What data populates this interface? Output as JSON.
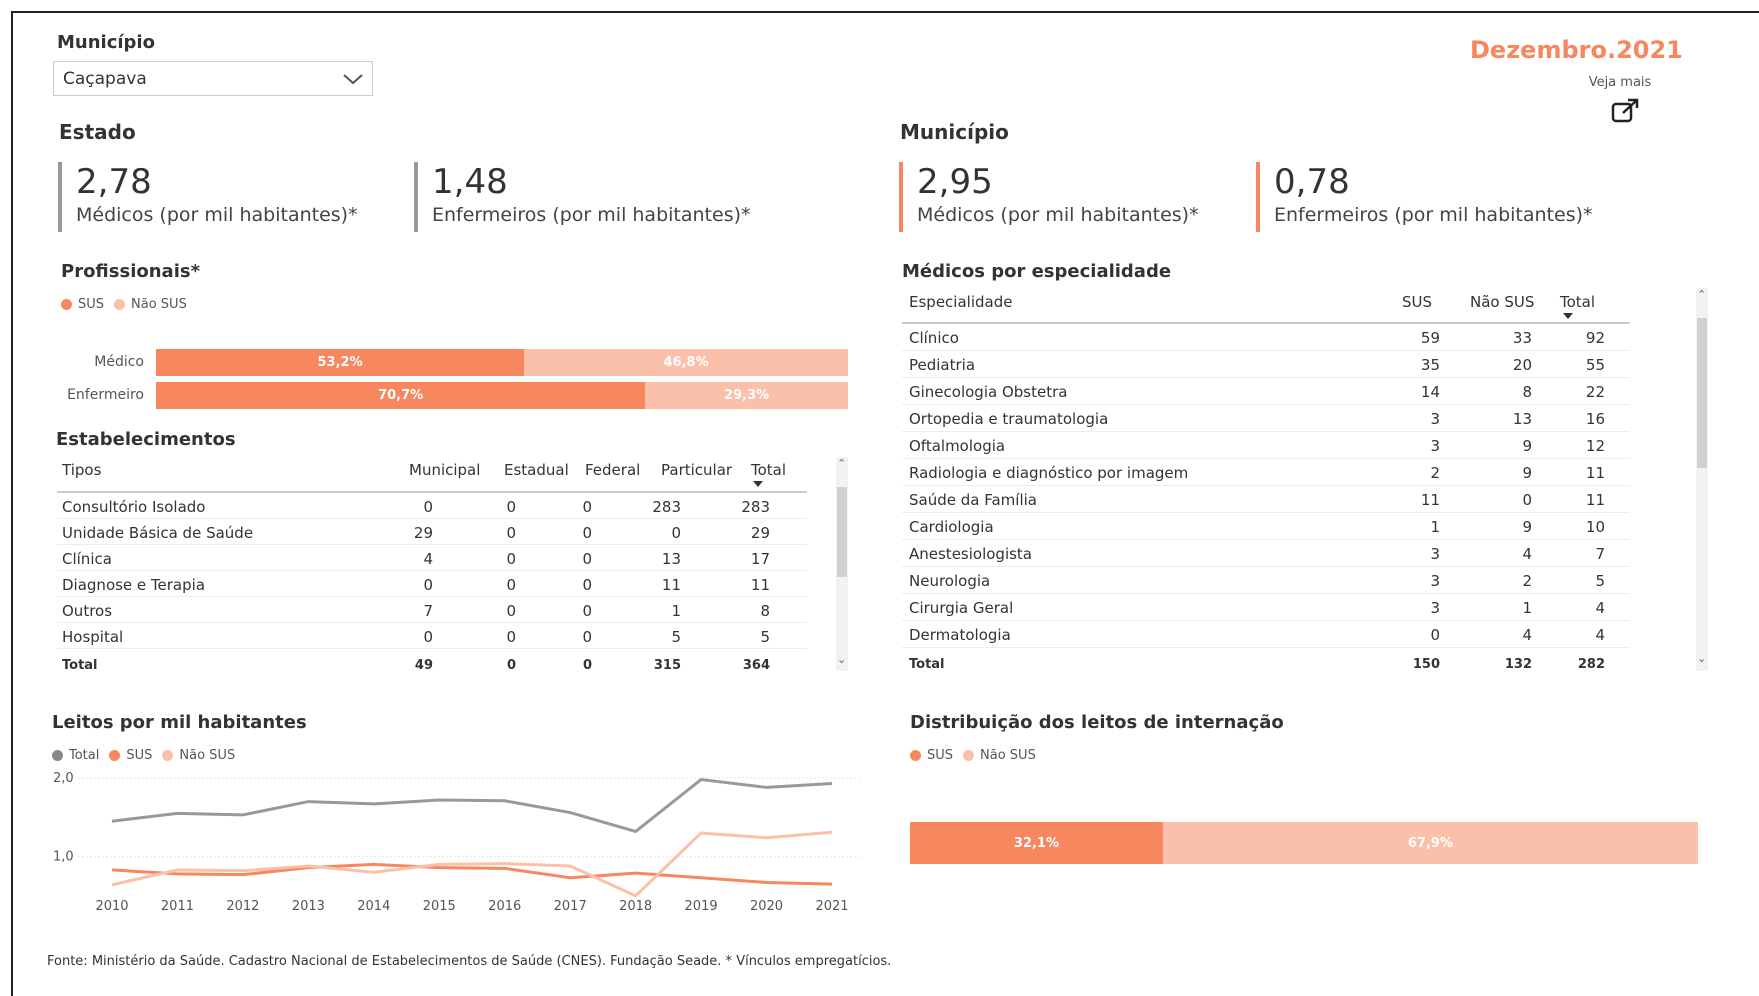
{
  "filter": {
    "label": "Município",
    "selected": "Caçapava"
  },
  "date": {
    "label": "Dezembro.2021",
    "see_more": "Veja mais",
    "color": "#f6875e"
  },
  "colors": {
    "sus": "#f6875e",
    "nao_sus": "#fbc0aa",
    "total": "#888888"
  },
  "estado": {
    "title": "Estado",
    "kpis": [
      {
        "value": "2,78",
        "caption": "Médicos (por mil habitantes)*"
      },
      {
        "value": "1,48",
        "caption": "Enfermeiros (por mil habitantes)*"
      }
    ]
  },
  "municipio": {
    "title": "Município",
    "kpis": [
      {
        "value": "2,95",
        "caption": "Médicos (por mil habitantes)*"
      },
      {
        "value": "0,78",
        "caption": "Enfermeiros (por mil habitantes)*"
      }
    ]
  },
  "profissionais": {
    "title": "Profissionais*",
    "legend": {
      "sus": "SUS",
      "nao_sus": "Não SUS"
    },
    "rows": [
      {
        "label": "Médico",
        "sus_pct": 53.2,
        "sus_label": "53,2%",
        "nsus_label": "46,8%"
      },
      {
        "label": "Enfermeiro",
        "sus_pct": 70.7,
        "sus_label": "70,7%",
        "nsus_label": "29,3%"
      }
    ]
  },
  "estabelecimentos": {
    "title": "Estabelecimentos",
    "columns": [
      "Tipos",
      "Municipal",
      "Estadual",
      "Federal",
      "Particular",
      "Total"
    ],
    "rows": [
      [
        "Consultório Isolado",
        "0",
        "0",
        "0",
        "283",
        "283"
      ],
      [
        "Unidade Básica de Saúde",
        "29",
        "0",
        "0",
        "0",
        "29"
      ],
      [
        "Clínica",
        "4",
        "0",
        "0",
        "13",
        "17"
      ],
      [
        "Diagnose e Terapia",
        "0",
        "0",
        "0",
        "11",
        "11"
      ],
      [
        "Outros",
        "7",
        "0",
        "0",
        "1",
        "8"
      ],
      [
        "Hospital",
        "0",
        "0",
        "0",
        "5",
        "5"
      ]
    ],
    "total": [
      "Total",
      "49",
      "0",
      "0",
      "315",
      "364"
    ]
  },
  "medicos_especialidade": {
    "title": "Médicos por especialidade",
    "columns": [
      "Especialidade",
      "SUS",
      "Não SUS",
      "Total"
    ],
    "rows": [
      [
        "Clínico",
        "59",
        "33",
        "92"
      ],
      [
        "Pediatria",
        "35",
        "20",
        "55"
      ],
      [
        "Ginecologia Obstetra",
        "14",
        "8",
        "22"
      ],
      [
        "Ortopedia e traumatologia",
        "3",
        "13",
        "16"
      ],
      [
        "Oftalmologia",
        "3",
        "9",
        "12"
      ],
      [
        "Radiologia e diagnóstico por imagem",
        "2",
        "9",
        "11"
      ],
      [
        "Saúde da Família",
        "11",
        "0",
        "11"
      ],
      [
        "Cardiologia",
        "1",
        "9",
        "10"
      ],
      [
        "Anestesiologista",
        "3",
        "4",
        "7"
      ],
      [
        "Neurologia",
        "3",
        "2",
        "5"
      ],
      [
        "Cirurgia Geral",
        "3",
        "1",
        "4"
      ],
      [
        "Dermatologia",
        "0",
        "4",
        "4"
      ]
    ],
    "total": [
      "Total",
      "150",
      "132",
      "282"
    ]
  },
  "leitos": {
    "title": "Leitos por mil habitantes",
    "legend": {
      "total": "Total",
      "sus": "SUS",
      "nao_sus": "Não SUS"
    }
  },
  "distribuicao": {
    "title": "Distribuição dos leitos de internação",
    "legend": {
      "sus": "SUS",
      "nao_sus": "Não SUS"
    },
    "sus_pct": 32.1,
    "sus_label": "32,1%",
    "nsus_label": "67,9%"
  },
  "chart_data": {
    "type": "line",
    "x": [
      "2010",
      "2011",
      "2012",
      "2013",
      "2014",
      "2015",
      "2016",
      "2017",
      "2018",
      "2019",
      "2020",
      "2021"
    ],
    "yticks": [
      "2,0",
      "1,0"
    ],
    "ylim": [
      0.6,
      2.0
    ],
    "series": [
      {
        "name": "Total",
        "values": [
          1.45,
          1.55,
          1.53,
          1.7,
          1.67,
          1.72,
          1.71,
          1.56,
          1.32,
          1.98,
          1.88,
          1.93
        ]
      },
      {
        "name": "SUS",
        "values": [
          0.83,
          0.78,
          0.77,
          0.86,
          0.9,
          0.86,
          0.85,
          0.73,
          0.79,
          0.73,
          0.67,
          0.65
        ]
      },
      {
        "name": "Não SUS",
        "values": [
          0.64,
          0.83,
          0.82,
          0.88,
          0.8,
          0.9,
          0.91,
          0.88,
          0.5,
          1.3,
          1.24,
          1.31
        ]
      }
    ]
  },
  "footer": "Fonte: Ministério da Saúde. Cadastro Nacional de Estabelecimentos de Saúde (CNES). Fundação Seade. * Vínculos empregatícios."
}
